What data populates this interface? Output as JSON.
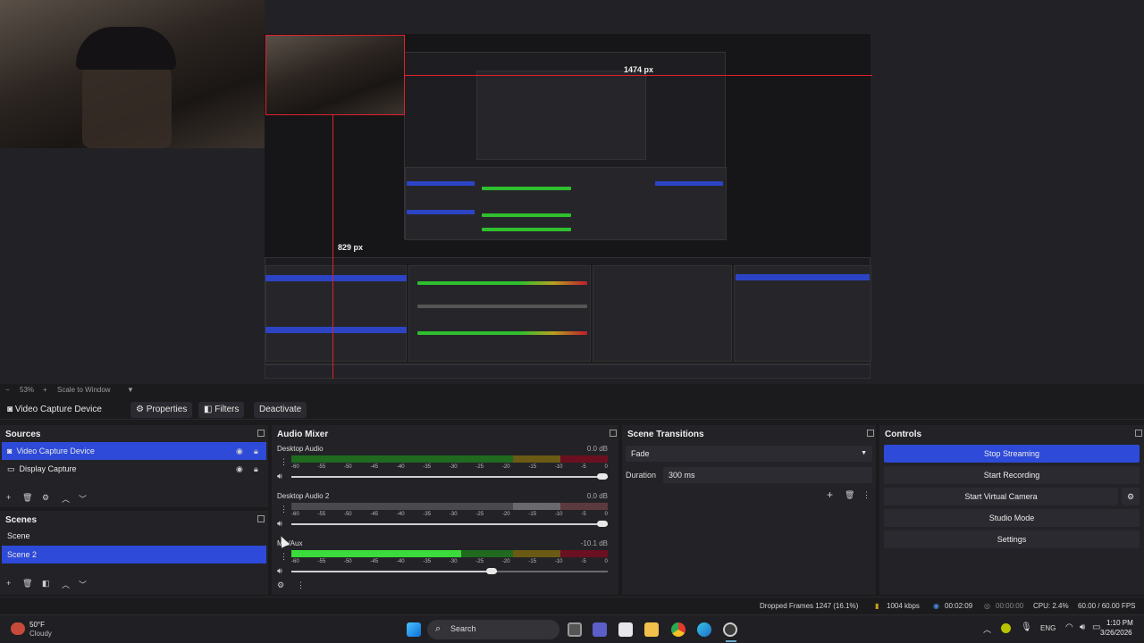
{
  "preview": {
    "measure_h": "1474 px",
    "measure_v": "829 px"
  },
  "preview_status": {
    "zoom": "53%",
    "scale_mode": "Scale to Window"
  },
  "source_toolbar": {
    "source_name": "Video Capture Device",
    "properties": "Properties",
    "filters": "Filters",
    "deactivate": "Deactivate"
  },
  "sources": {
    "title": "Sources",
    "items": [
      {
        "label": "Video Capture Device",
        "selected": true
      },
      {
        "label": "Display Capture",
        "selected": false
      }
    ]
  },
  "scenes": {
    "title": "Scenes",
    "items": [
      {
        "label": "Scene",
        "selected": false
      },
      {
        "label": "Scene 2",
        "selected": true
      }
    ]
  },
  "mixer": {
    "title": "Audio Mixer",
    "scale": [
      "-60",
      "-55",
      "-50",
      "-45",
      "-40",
      "-35",
      "-30",
      "-25",
      "-20",
      "-15",
      "-10",
      "-5",
      "0"
    ],
    "channels": [
      {
        "name": "Desktop Audio",
        "db": "0.0 dB",
        "volume": 1.0
      },
      {
        "name": "Desktop Audio 2",
        "db": "0.0 dB",
        "volume": 1.0
      },
      {
        "name": "Mic/Aux",
        "db": "-10.1 dB",
        "volume": 0.65
      }
    ]
  },
  "transitions": {
    "title": "Scene Transitions",
    "type": "Fade",
    "duration_label": "Duration",
    "duration_value": "300 ms"
  },
  "controls": {
    "title": "Controls",
    "stop_streaming": "Stop Streaming",
    "start_recording": "Start Recording",
    "start_virtual_camera": "Start Virtual Camera",
    "studio_mode": "Studio Mode",
    "settings": "Settings"
  },
  "status": {
    "dropped_frames": "Dropped Frames 1247 (16.1%)",
    "bitrate": "1004 kbps",
    "stream_time": "00:02:09",
    "record_time": "00:00:00",
    "cpu": "CPU: 2.4%",
    "fps": "60.00 / 60.00 FPS"
  },
  "taskbar": {
    "weather_temp": "50°F",
    "weather_desc": "Cloudy",
    "search": "Search",
    "lang": "ENG",
    "time": "1:10 PM",
    "date": "3/26/2026"
  },
  "colors": {
    "accent": "#2d4ad8",
    "meter_green": "#2fbf2f",
    "meter_yellow": "#b8a020",
    "meter_red": "#c01c2c",
    "guide_red": "#e0202a"
  }
}
